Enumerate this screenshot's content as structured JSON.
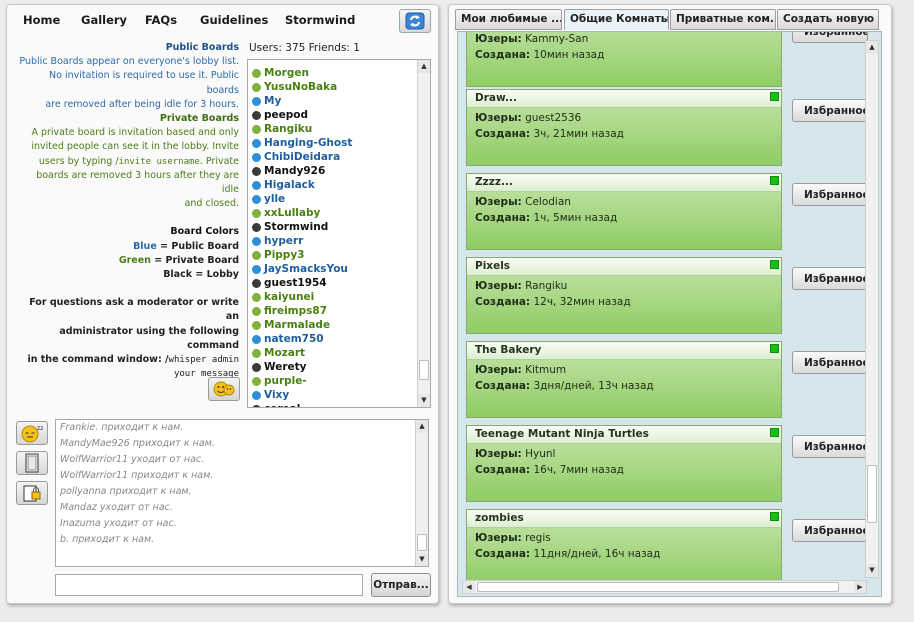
{
  "nav": {
    "items": [
      "Home",
      "Gallery",
      "FAQs",
      "Guidelines",
      "Stormwind"
    ],
    "refresh_icon": "refresh-icon"
  },
  "info": {
    "public_heading": "Public Boards",
    "public_lines": [
      "Public Boards appear on everyone's lobby list.",
      "No invitation is required to use it. Public boards",
      "are removed after being idle for 3 hours."
    ],
    "private_heading": "Private Boards",
    "private_line1": "A private board is invitation based and only",
    "private_line2": "invited people can see it in the lobby. Invite",
    "private_line3_pre": "users by typing /",
    "private_line3_code": "invite username",
    "private_line3_post": ". Private",
    "private_line4": "boards are removed 3 hours after they are idle",
    "private_line5": "and closed.",
    "colors_heading": "Board Colors",
    "color_blue_name": "Blue",
    "color_blue_desc": " = Public Board",
    "color_green_name": "Green",
    "color_green_desc": " = Private Board",
    "color_black_name": "Black",
    "color_black_desc": " = Lobby",
    "help_line1": "For questions ask a moderator or write an",
    "help_line2": "administrator using the following command",
    "help_line3_pre": "in the command window: /",
    "help_line3_code": "whisper admin",
    "help_line4_code": "your message"
  },
  "users": {
    "header": "Users: 375 Friends: 1",
    "list": [
      {
        "name": "Morgen",
        "status": "green"
      },
      {
        "name": "YusuNoBaka",
        "status": "green"
      },
      {
        "name": "My",
        "status": "blue"
      },
      {
        "name": "peepod",
        "status": "black"
      },
      {
        "name": "Rangiku",
        "status": "green"
      },
      {
        "name": "Hanging-Ghost",
        "status": "blue"
      },
      {
        "name": "ChibiDeidara",
        "status": "blue"
      },
      {
        "name": "Mandy926",
        "status": "black"
      },
      {
        "name": "Higalack",
        "status": "blue"
      },
      {
        "name": "ylle",
        "status": "blue"
      },
      {
        "name": "xxLullaby",
        "status": "green"
      },
      {
        "name": "Stormwind",
        "status": "black"
      },
      {
        "name": "hyperr",
        "status": "blue"
      },
      {
        "name": "Pippy3",
        "status": "green"
      },
      {
        "name": "JaySmacksYou",
        "status": "blue"
      },
      {
        "name": "guest1954",
        "status": "black"
      },
      {
        "name": "kaiyunei",
        "status": "green"
      },
      {
        "name": "fireimps87",
        "status": "green"
      },
      {
        "name": "Marmalade",
        "status": "green"
      },
      {
        "name": "natem750",
        "status": "blue"
      },
      {
        "name": "Mozart",
        "status": "green"
      },
      {
        "name": "Werety",
        "status": "black"
      },
      {
        "name": "purple-",
        "status": "green"
      },
      {
        "name": "Vixy",
        "status": "blue"
      },
      {
        "name": "cereal.",
        "status": "black"
      }
    ]
  },
  "colors": {
    "green_text": "#4a7f12",
    "blue_text": "#1f5e9c",
    "black_text": "#111111",
    "green_dot": "#7fb13c",
    "blue_dot": "#2e8fd8",
    "black_dot": "#3a3a3a"
  },
  "chat": {
    "lines": [
      "Frankie. приходит к нам.",
      "MandyMae926 приходит к нам.",
      "WolfWarrior11 уходит от нас.",
      "WolfWarrior11 приходит к нам.",
      "pollyanna приходит к нам.",
      "Mandaz уходит от нас.",
      "Inazuma уходит от нас.",
      "b. приходит к нам."
    ],
    "input_value": "",
    "send_label": "Отправ..."
  },
  "tools": {
    "emote_icon": "smiley-icon",
    "sleep_icon": "sleepy-smiley-icon",
    "board_icon": "whiteboard-icon",
    "lock_icon": "private-board-icon"
  },
  "tabs": [
    {
      "label": "Мои любимые ...",
      "active": false
    },
    {
      "label": "Общие Комнаты.",
      "active": true
    },
    {
      "label": "Приватные ком...",
      "active": false
    },
    {
      "label": "Создать новую ...",
      "active": false
    }
  ],
  "rooms": {
    "users_label": "Юзеры:",
    "created_label": "Создана:",
    "fav_label": "Избранное",
    "list": [
      {
        "title": "",
        "users": "Kammy-San",
        "created": "10мин назад"
      },
      {
        "title": "Draw...",
        "users": "guest2536",
        "created": "3ч, 21мин назад"
      },
      {
        "title": "Zzzz...",
        "users": "Celodian",
        "created": "1ч, 5мин назад"
      },
      {
        "title": "Pixels",
        "users": "Rangiku",
        "created": "12ч, 32мин назад"
      },
      {
        "title": "The Bakery",
        "users": "Kitmum",
        "created": "3дня/дней, 13ч назад"
      },
      {
        "title": "Teenage Mutant Ninja Turtles",
        "users": "Hyunl",
        "created": "16ч, 7мин назад"
      },
      {
        "title": "zombies",
        "users": "regis",
        "created": "11дня/дней, 16ч назад"
      }
    ]
  }
}
